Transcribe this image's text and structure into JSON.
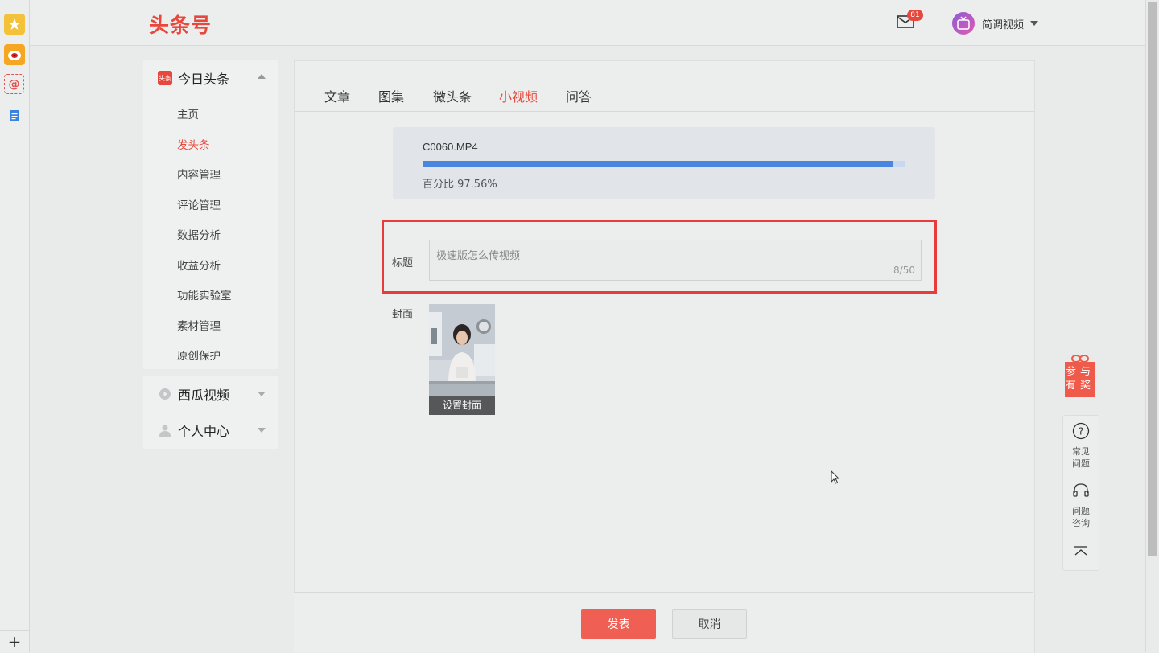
{
  "brand": {
    "logo": "头条号",
    "accent": "#e8473c"
  },
  "header": {
    "mail_badge": "81",
    "user_name": "简调视频"
  },
  "sidebar": {
    "section1": {
      "title": "今日头条",
      "icon_text": "头条",
      "items": [
        "主页",
        "发头条",
        "内容管理",
        "评论管理",
        "数据分析",
        "收益分析",
        "功能实验室",
        "素材管理",
        "原创保护"
      ],
      "active_index": 1
    },
    "section2": {
      "title": "西瓜视频"
    },
    "section3": {
      "title": "个人中心"
    }
  },
  "tabs": {
    "items": [
      "文章",
      "图集",
      "微头条",
      "小视频",
      "问答"
    ],
    "active": "小视频"
  },
  "upload": {
    "file_name": "C0060.MP4",
    "progress": 0.9756,
    "percent_text": "百分比 97.56%"
  },
  "form": {
    "title_label": "标题",
    "title_value": "极速版怎么传视频",
    "title_count": "8/50",
    "cover_label": "封面",
    "cover_button": "设置封面"
  },
  "footer": {
    "publish": "发表",
    "cancel": "取消"
  },
  "float": {
    "gift_text": "参与有奖",
    "faq": "常见问题",
    "consult": "问题咨询"
  },
  "colors": {
    "progress_fill": "#4a86dd",
    "progress_track": "#c9d8ee",
    "publish_button": "#ef5f53",
    "highlight_border": "#e83c3c"
  }
}
